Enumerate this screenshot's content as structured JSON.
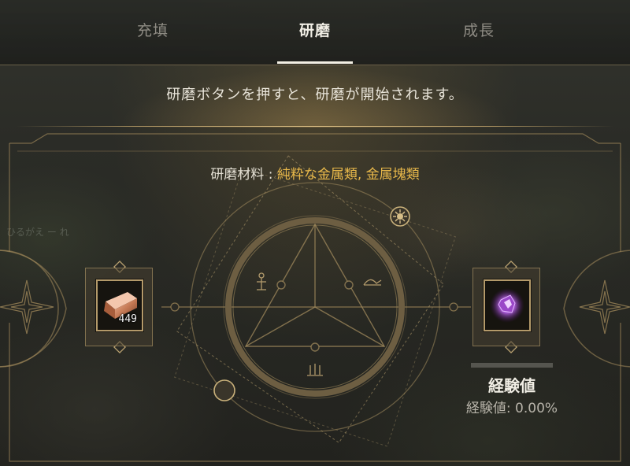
{
  "tabs": [
    {
      "label": "充填",
      "active": false
    },
    {
      "label": "研磨",
      "active": true
    },
    {
      "label": "成長",
      "active": false
    }
  ],
  "hint_text": "研磨ボタンを押すと、研磨が開始されます。",
  "material": {
    "label": "研磨材料 : ",
    "value": "純粋な金属類, 金属塊類"
  },
  "input_slot": {
    "icon": "copper-ingot-icon",
    "count": "449"
  },
  "output_slot": {
    "icon": "purple-crystal-icon",
    "progress": 0.0
  },
  "experience": {
    "title": "経験値",
    "value_text": "経験値: 0.00%"
  },
  "colors": {
    "accent_gold": "#e8b84a",
    "frame_gold": "#b49a6a",
    "text_light": "#f0ede4"
  },
  "decor_icons": [
    "compass-star-icon",
    "sun-icon",
    "moon-icon",
    "ankh-icon",
    "snail-icon",
    "candles-icon",
    "diamond-icon"
  ],
  "background_text": "ひるがえ ー れ"
}
